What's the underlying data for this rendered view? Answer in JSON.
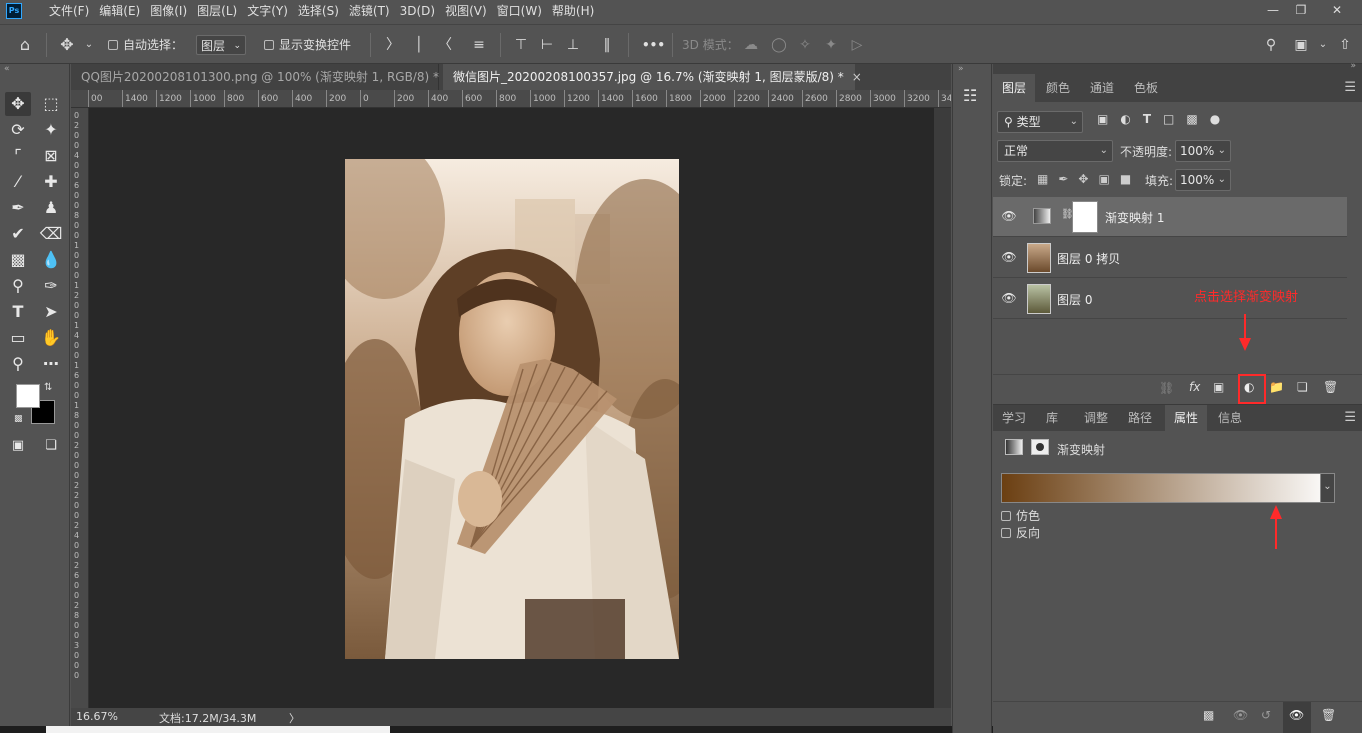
{
  "app": {
    "logo": "Ps",
    "menus": [
      "文件(F)",
      "编辑(E)",
      "图像(I)",
      "图层(L)",
      "文字(Y)",
      "选择(S)",
      "滤镜(T)",
      "3D(D)",
      "视图(V)",
      "窗口(W)",
      "帮助(H)"
    ],
    "window_controls": [
      "minimize-icon",
      "restore-icon",
      "close-icon"
    ]
  },
  "options_bar": {
    "auto_select_label": "自动选择：",
    "auto_select_target": "图层",
    "show_transform_label": "显示变换控件",
    "more_label": "•••",
    "mode_3d_label": "3D 模式："
  },
  "tabs": [
    {
      "title": "QQ图片20200208101300.png @ 100% (渐变映射 1, RGB/8) *",
      "close": "×"
    },
    {
      "title": "微信图片_20200208100357.jpg @ 16.7% (渐变映射 1, 图层蒙版/8) *",
      "close": "×"
    }
  ],
  "ruler": {
    "h_ticks": [
      "00",
      "1400",
      "1200",
      "1000",
      "800",
      "600",
      "400",
      "200",
      "0",
      "200",
      "400",
      "600",
      "800",
      "1000",
      "1200",
      "1400",
      "1600",
      "1800",
      "2000",
      "2200",
      "2400",
      "2600",
      "2800",
      "3000",
      "3200",
      "3400"
    ],
    "v_ticks": [
      "0",
      "2",
      "0",
      "0",
      "4",
      "0",
      "0",
      "6",
      "0",
      "0",
      "8",
      "0",
      "0",
      "1",
      "0",
      "0",
      "0",
      "1",
      "2",
      "0",
      "0",
      "1",
      "4",
      "0",
      "0",
      "1",
      "6",
      "0",
      "0",
      "1",
      "8",
      "0",
      "0",
      "2",
      "0",
      "0",
      "0",
      "2",
      "2",
      "0",
      "0",
      "2",
      "4",
      "0",
      "0",
      "2",
      "6",
      "0",
      "0",
      "2",
      "8",
      "0",
      "0",
      "3",
      "0",
      "0",
      "0"
    ]
  },
  "status": {
    "zoom": "16.67%",
    "doc_info": "文档:17.2M/34.3M",
    "arrow": "〉"
  },
  "layers_panel": {
    "tabs": [
      "图层",
      "颜色",
      "通道",
      "色板"
    ],
    "filter_kind": "类型",
    "blend_mode": "正常",
    "opacity_label": "不透明度:",
    "opacity_value": "100%",
    "lock_label": "锁定:",
    "fill_label": "填充:",
    "fill_value": "100%",
    "layers": [
      {
        "name": "渐变映射 1",
        "selected": true
      },
      {
        "name": "图层 0 拷贝",
        "selected": false
      },
      {
        "name": "图层 0",
        "selected": false
      }
    ],
    "annotation": "点击选择渐变映射",
    "bottom_labels": [
      "fx"
    ]
  },
  "properties_panel": {
    "tabs": [
      "学习",
      "库",
      "调整",
      "路径",
      "属性",
      "信息"
    ],
    "title": "渐变映射",
    "gradient_start": "#6b3f12",
    "gradient_end": "#ffffff",
    "dither_label": "仿色",
    "reverse_label": "反向"
  }
}
